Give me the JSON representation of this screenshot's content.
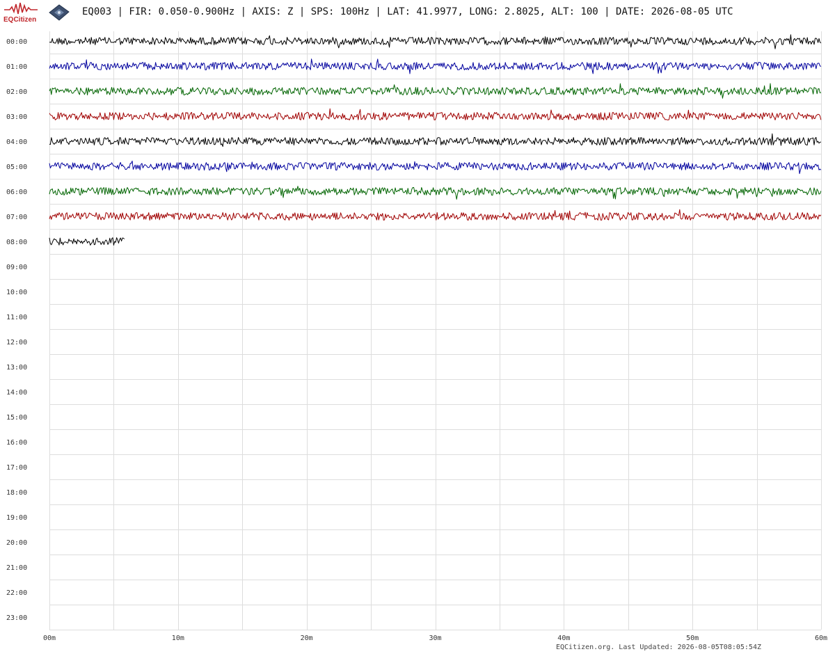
{
  "header": {
    "logo_text": "EQCitizen",
    "title": "EQ003 | FIR: 0.050-0.900Hz | AXIS: Z | SPS: 100Hz | LAT: 41.9977, LONG: 2.8025, ALT: 100 | DATE: 2026-08-05 UTC"
  },
  "footer": {
    "note": "EQCitizen.org. Last Updated: 2026-08-05T08:05:54Z"
  },
  "icons": {
    "logo": "seismograph-logo-icon",
    "device": "sensor-board-icon"
  },
  "colors": {
    "trace_cycle": [
      "#000000",
      "#00009e",
      "#006400",
      "#a00000"
    ],
    "grid": "#dddddd",
    "brand": "#c0262b"
  },
  "chart_data": {
    "type": "line",
    "title": "",
    "xlabel": "",
    "ylabel": "",
    "x_ticks": [
      "00m",
      "10m",
      "20m",
      "30m",
      "40m",
      "50m",
      "60m"
    ],
    "x_range_minutes": [
      0,
      60
    ],
    "x_minor_step_minutes": 5,
    "row_labels": [
      "00:00",
      "01:00",
      "02:00",
      "03:00",
      "04:00",
      "05:00",
      "06:00",
      "07:00",
      "08:00",
      "09:00",
      "10:00",
      "11:00",
      "12:00",
      "13:00",
      "14:00",
      "15:00",
      "16:00",
      "17:00",
      "18:00",
      "19:00",
      "20:00",
      "21:00",
      "22:00",
      "23:00"
    ],
    "grid": true,
    "series": [
      {
        "row": "00:00",
        "minutes": 60,
        "color": "#000000"
      },
      {
        "row": "01:00",
        "minutes": 60,
        "color": "#00009e"
      },
      {
        "row": "02:00",
        "minutes": 60,
        "color": "#006400"
      },
      {
        "row": "03:00",
        "minutes": 60,
        "color": "#a00000"
      },
      {
        "row": "04:00",
        "minutes": 60,
        "color": "#000000"
      },
      {
        "row": "05:00",
        "minutes": 60,
        "color": "#00009e"
      },
      {
        "row": "06:00",
        "minutes": 60,
        "color": "#006400"
      },
      {
        "row": "07:00",
        "minutes": 60,
        "color": "#a00000"
      },
      {
        "row": "08:00",
        "minutes": 5.9,
        "color": "#000000"
      }
    ]
  }
}
